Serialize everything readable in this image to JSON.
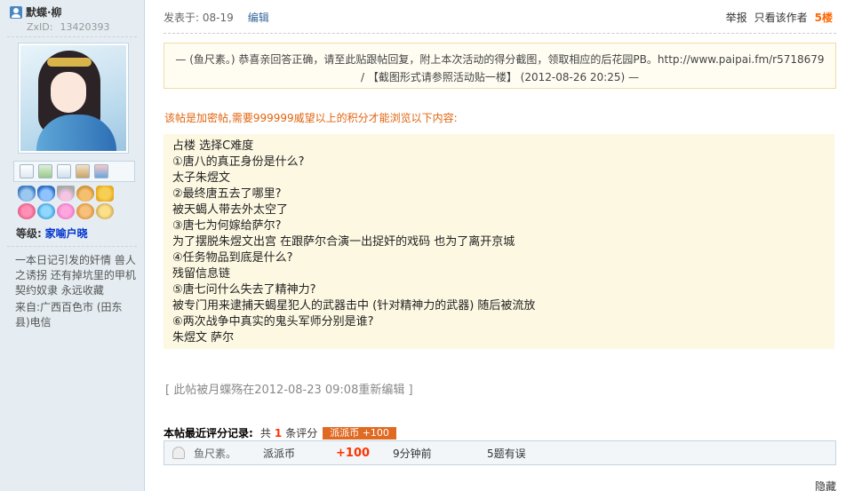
{
  "user": {
    "name": "默蝶·柳",
    "zxid_label": "ZxID:",
    "zxid": "13420393",
    "level_label": "等级:",
    "level": "家喻户晓",
    "signature": "一本日记引发的奸情 兽人之诱拐 还有掉坑里的甲机契约奴隶 永远收藏",
    "from": "来自:广西百色市 (田东县)电信"
  },
  "post": {
    "posted_label": "发表于: 08-19",
    "edit_label": "编辑",
    "report_label": "举报",
    "author_only_label": "只看该作者",
    "floor": "5楼",
    "quote_line1": "— (鱼尺素。) 恭喜亲回答正确，请至此贴跟帖回复，附上本次活动的得分截图，领取相应的后花园PB。http://www.paipai.fm/r5718679",
    "quote_line2": "/ 【截图形式请参照活动贴一楼】 (2012-08-26 20:25) —",
    "encrypted_notice": "该帖是加密帖,需要999999威望以上的积分才能浏览以下内容:",
    "content_lines": [
      "占楼 选择C难度",
      "①唐八的真正身份是什么?",
      "太子朱煜文",
      "②最终唐五去了哪里?",
      "被天蝎人带去外太空了",
      "③唐七为何嫁给萨尔?",
      "为了摆脱朱煜文出宫  在跟萨尔合演一出捉奸的戏码  也为了离开京城",
      "④任务物品到底是什么?",
      "残留信息链",
      "⑤唐七问什么失去了精神力?",
      "被专门用来逮捕天蝎星犯人的武器击中 (针对精神力的武器) 随后被流放",
      "⑥两次战争中真实的鬼头军师分别是谁?",
      "朱煜文  萨尔"
    ],
    "edited_note": "[ 此帖被月蝶殇在2012-08-23 09:08重新编辑 ]"
  },
  "rating": {
    "title": "本帖最近评分记录:",
    "count_prefix": "共",
    "count": "1",
    "count_suffix": "条评分",
    "tag": "派派币 +100",
    "rows": [
      {
        "user": "鱼尺素。",
        "type": "派派币",
        "score": "+100",
        "time": "9分钟前",
        "reason": "5题有误"
      }
    ]
  },
  "hide_label": "隐藏"
}
